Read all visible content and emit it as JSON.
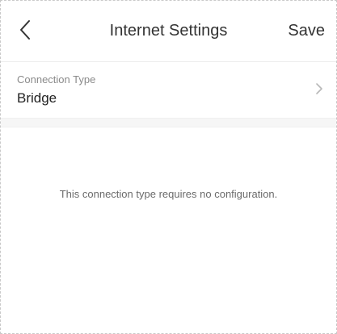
{
  "header": {
    "title": "Internet Settings",
    "save_label": "Save"
  },
  "connection": {
    "label": "Connection Type",
    "value": "Bridge"
  },
  "message": "This connection type requires no configuration.",
  "icons": {
    "back": "chevron-left-icon",
    "row": "chevron-right-icon"
  },
  "colors": {
    "text": "#333333",
    "muted": "#8a8a8a",
    "divider": "#f6f6f6"
  }
}
